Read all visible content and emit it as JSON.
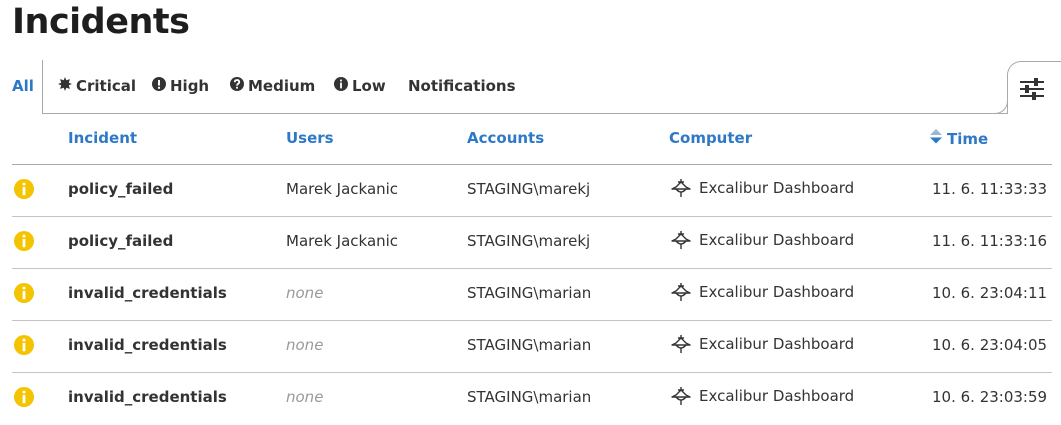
{
  "page": {
    "title": "Incidents"
  },
  "tabs": [
    {
      "label": "All",
      "icon": "",
      "active": true
    },
    {
      "label": "Critical",
      "icon": "burst-icon",
      "active": false
    },
    {
      "label": "High",
      "icon": "exclamation-circle-icon",
      "active": false
    },
    {
      "label": "Medium",
      "icon": "question-circle-icon",
      "active": false
    },
    {
      "label": "Low",
      "icon": "info-circle-icon",
      "active": false
    },
    {
      "label": "Notifications",
      "icon": "",
      "active": false
    }
  ],
  "settings_icon": "sliders-icon",
  "columns": {
    "incident": "Incident",
    "users": "Users",
    "accounts": "Accounts",
    "computer": "Computer",
    "time": "Time"
  },
  "sort_icon": "sort-icon",
  "colors": {
    "accent": "#2e79c7",
    "severity_low": "#f5c400",
    "none_text": "#9a9a9a"
  },
  "rows": [
    {
      "severity": "low",
      "severity_icon": "info-circle-icon",
      "incident": "policy_failed",
      "user": "Marek Jackanic",
      "user_none": false,
      "account": "STAGING\\marekj",
      "computer": "Excalibur Dashboard",
      "time": "11. 6. 11:33:33"
    },
    {
      "severity": "low",
      "severity_icon": "info-circle-icon",
      "incident": "policy_failed",
      "user": "Marek Jackanic",
      "user_none": false,
      "account": "STAGING\\marekj",
      "computer": "Excalibur Dashboard",
      "time": "11. 6. 11:33:16"
    },
    {
      "severity": "low",
      "severity_icon": "info-circle-icon",
      "incident": "invalid_credentials",
      "user": "none",
      "user_none": true,
      "account": "STAGING\\marian",
      "computer": "Excalibur Dashboard",
      "time": "10. 6. 23:04:11"
    },
    {
      "severity": "low",
      "severity_icon": "info-circle-icon",
      "incident": "invalid_credentials",
      "user": "none",
      "user_none": true,
      "account": "STAGING\\marian",
      "computer": "Excalibur Dashboard",
      "time": "10. 6. 23:04:05"
    },
    {
      "severity": "low",
      "severity_icon": "info-circle-icon",
      "incident": "invalid_credentials",
      "user": "none",
      "user_none": true,
      "account": "STAGING\\marian",
      "computer": "Excalibur Dashboard",
      "time": "10. 6. 23:03:59"
    }
  ]
}
